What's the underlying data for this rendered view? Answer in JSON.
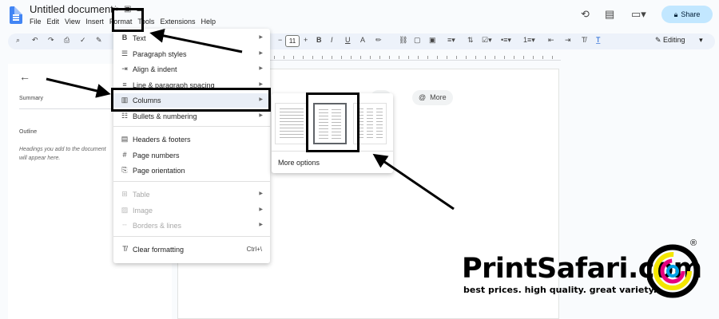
{
  "header": {
    "doc_title": "Untitled document",
    "menus": [
      "File",
      "Edit",
      "View",
      "Insert",
      "Format",
      "Tools",
      "Extensions",
      "Help"
    ],
    "share_label": "Share",
    "brand_color": "#4285f4",
    "share_bg": "#c2e7ff"
  },
  "toolbar": {
    "font_size": "11",
    "mode_label": "Editing"
  },
  "left_panel": {
    "summary_label": "Summary",
    "outline_label": "Outline",
    "outline_hint": "Headings you add to the document will appear here."
  },
  "page_chips": {
    "draft_fragment": "aft",
    "more_label": "More"
  },
  "format_menu": {
    "items": [
      {
        "icon": "bold-b-icon",
        "label": "Text",
        "submenu": true,
        "disabled": false
      },
      {
        "icon": "paragraph-styles-icon",
        "label": "Paragraph styles",
        "submenu": true,
        "disabled": false
      },
      {
        "icon": "align-indent-icon",
        "label": "Align & indent",
        "submenu": true,
        "disabled": false
      },
      {
        "icon": "line-spacing-icon",
        "label": "Line & paragraph spacing",
        "submenu": true,
        "disabled": false
      },
      {
        "icon": "columns-icon",
        "label": "Columns",
        "submenu": true,
        "disabled": false
      },
      {
        "icon": "bullets-icon",
        "label": "Bullets & numbering",
        "submenu": true,
        "disabled": false
      },
      {
        "icon": "headers-footers-icon",
        "label": "Headers & footers",
        "submenu": false,
        "disabled": false
      },
      {
        "icon": "hash-icon",
        "label": "Page numbers",
        "submenu": false,
        "disabled": false
      },
      {
        "icon": "page-orientation-icon",
        "label": "Page orientation",
        "submenu": false,
        "disabled": false
      },
      {
        "icon": "table-icon",
        "label": "Table",
        "submenu": true,
        "disabled": true
      },
      {
        "icon": "image-icon",
        "label": "Image",
        "submenu": true,
        "disabled": true
      },
      {
        "icon": "borders-lines-icon",
        "label": "Borders & lines",
        "submenu": true,
        "disabled": true
      },
      {
        "icon": "clear-formatting-icon",
        "label": "Clear formatting",
        "submenu": false,
        "disabled": false,
        "shortcut": "Ctrl+\\"
      }
    ]
  },
  "columns_submenu": {
    "more_options_label": "More options"
  },
  "watermark": {
    "brand": "PrintSafari.com",
    "tagline": "best prices. high quality. great variety."
  }
}
